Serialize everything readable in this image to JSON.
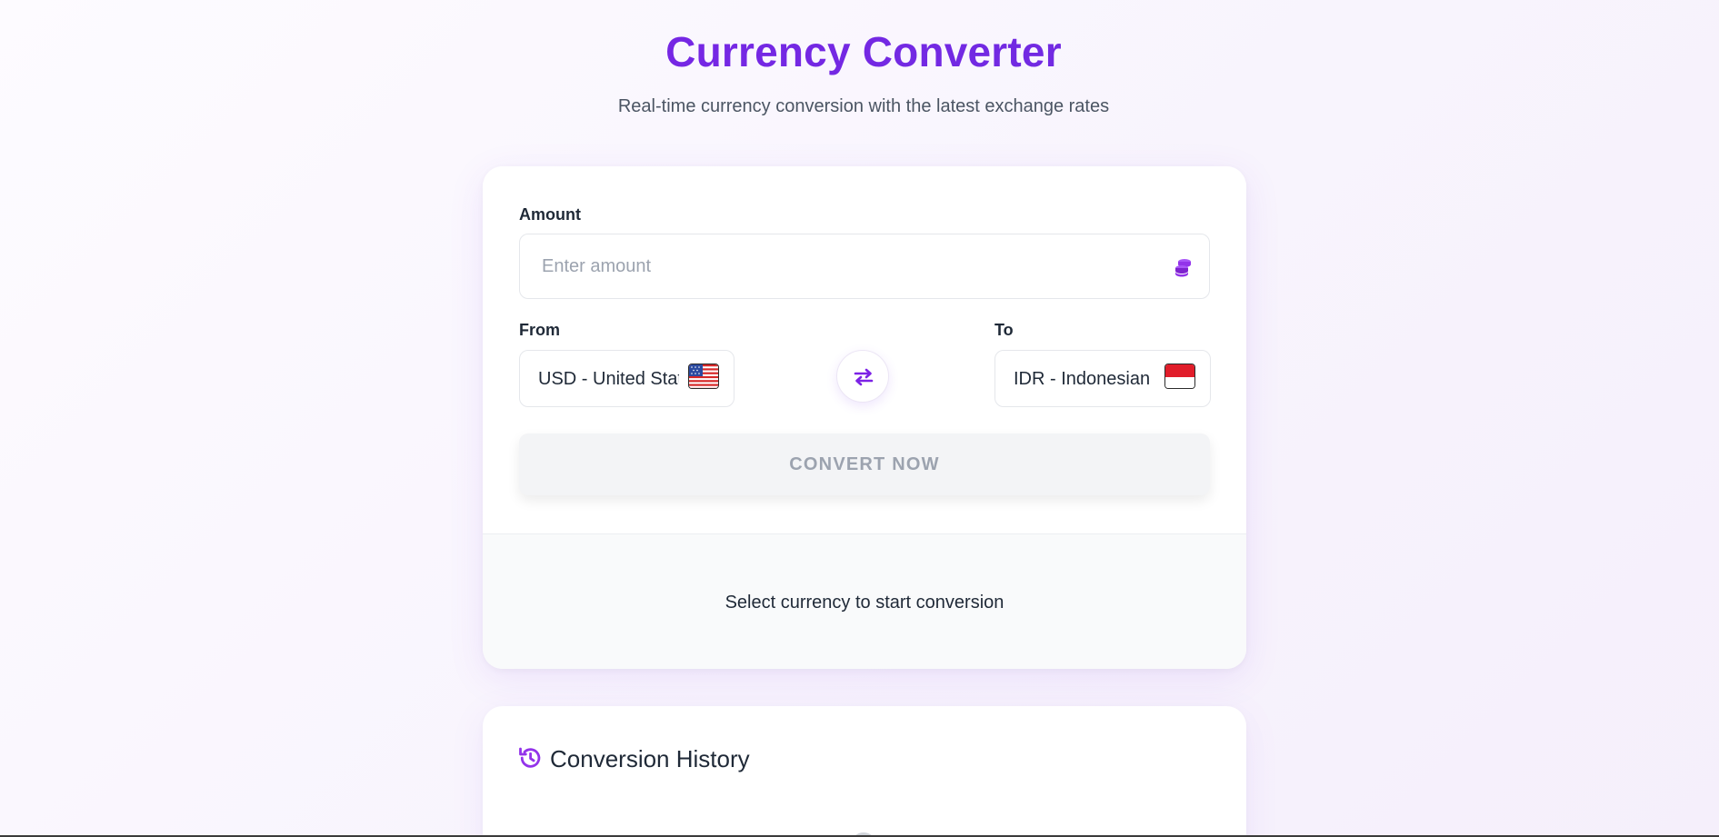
{
  "header": {
    "title": "Currency Converter",
    "subtitle": "Real-time currency conversion with the latest exchange rates"
  },
  "converter": {
    "amount_label": "Amount",
    "amount_placeholder": "Enter amount",
    "amount_value": "",
    "amount_icon": "coins-icon",
    "from_label": "From",
    "from_value": "USD - United States Dollar",
    "from_flag": "us-flag-icon",
    "to_label": "To",
    "to_value": "IDR - Indonesian Rupiah",
    "to_flag": "id-flag-icon",
    "swap_icon": "swap-arrows-icon",
    "convert_label": "CONVERT NOW",
    "result_message": "Select currency to start conversion"
  },
  "history": {
    "title": "Conversion History",
    "icon": "history-icon"
  },
  "colors": {
    "accent": "#7c22e6",
    "accent_secondary": "#a855f7",
    "disabled_bg": "#f3f4f6",
    "disabled_text": "#9ca3af"
  }
}
